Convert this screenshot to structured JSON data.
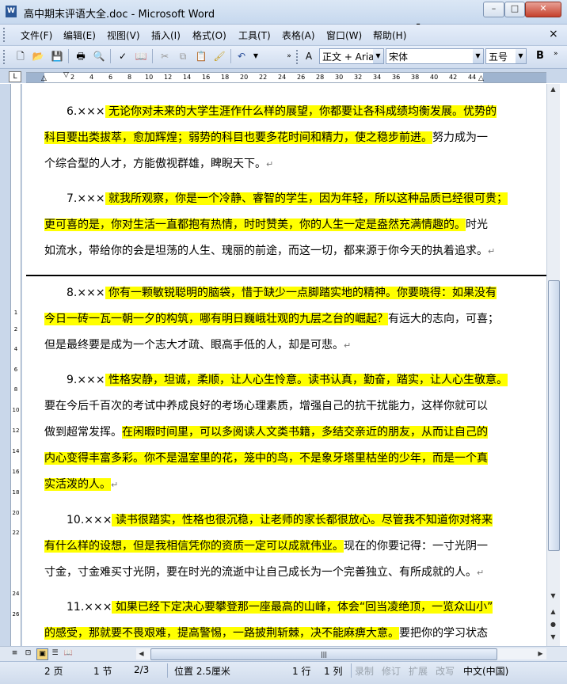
{
  "window": {
    "title": "高中期末评语大全.doc - Microsoft Word",
    "minimize": "–",
    "maximize": "□",
    "close": "✕"
  },
  "menu": [
    "文件(F)",
    "编辑(E)",
    "视图(V)",
    "插入(I)",
    "格式(O)",
    "工具(T)",
    "表格(A)",
    "窗口(W)",
    "帮助(H)"
  ],
  "menu_close": "×",
  "toolbar": {
    "style": "正文 + Aria",
    "font": "宋体",
    "size": "五号",
    "bold": "B"
  },
  "ruler": {
    "corner": "L",
    "numbers": [
      "2",
      "4",
      "6",
      "8",
      "10",
      "12",
      "14",
      "16",
      "18",
      "20",
      "22",
      "24",
      "26",
      "28",
      "30",
      "32",
      "34",
      "36",
      "38",
      "40",
      "42",
      "44"
    ],
    "vnumbers": [
      "1",
      "2",
      "4",
      "6",
      "8",
      "10",
      "12",
      "14",
      "16",
      "18",
      "20",
      "22",
      "24",
      "26"
    ]
  },
  "document": {
    "paragraphs": [
      {
        "id": "p6",
        "lines": [
          [
            {
              "t": "6.×××",
              "hl": false
            },
            {
              "t": " 无论你对未来的大学生涯作什么样的展望，你都要让各科成绩均衡发展。优势的",
              "hl": true
            }
          ],
          [
            {
              "t": "科目要出类拔萃，愈加辉煌；弱势的科目也要多花时间和精力，使之稳步前进。",
              "hl": true
            },
            {
              "t": "努力成为一",
              "hl": false
            }
          ],
          [
            {
              "t": "个综合型的人才，方能傲视群雄，睥睨天下。",
              "hl": false
            },
            {
              "t": "↵",
              "hl": false,
              "pm": true
            }
          ]
        ]
      },
      {
        "id": "p7",
        "lines": [
          [
            {
              "t": "7.×××",
              "hl": false
            },
            {
              "t": " 就我所观察，你是一个冷静、睿智的学生，因为年轻，所以这种品质已经很可贵；",
              "hl": true
            }
          ],
          [
            {
              "t": "更可喜的是，你对生活一直都抱有热情，时时赞美，你的人生一定是盎然充满情趣的。",
              "hl": true
            },
            {
              "t": "时光",
              "hl": false
            }
          ],
          [
            {
              "t": "如流水，带给你的会是坦荡的人生、瑰丽的前途，而这一切，都来源于你今天的执着追求。",
              "hl": false
            },
            {
              "t": "↵",
              "hl": false,
              "pm": true
            }
          ]
        ]
      },
      {
        "id": "p8",
        "lines": [
          [
            {
              "t": "8.×××",
              "hl": false
            },
            {
              "t": " 你有一颗敏锐聪明的脑袋，惜于缺少一点脚踏实地的精神。你要晓得：如果没有",
              "hl": true
            }
          ],
          [
            {
              "t": "今日一砖一瓦一朝一夕的构筑，哪有明日巍峨壮观的九层之台的崛起？",
              "hl": true
            },
            {
              "t": "有远大的志向，可喜；",
              "hl": false
            }
          ],
          [
            {
              "t": "但是最终要是成为一个志大才疏、眼高手低的人，却是可悲。",
              "hl": false
            },
            {
              "t": "↵",
              "hl": false,
              "pm": true
            }
          ]
        ]
      },
      {
        "id": "p9",
        "lines": [
          [
            {
              "t": "9.×××",
              "hl": false
            },
            {
              "t": " 性格安静，坦诚，柔顺，让人心生怜意。读书认真，勤奋，踏实，让人心生敬意。",
              "hl": true
            }
          ],
          [
            {
              "t": "要在今后千百次的考试中养成良好的考场心理素质，增强自己的抗干扰能力，这样你就可以",
              "hl": false
            }
          ],
          [
            {
              "t": "做到超常发挥。",
              "hl": false
            },
            {
              "t": "在闲暇时间里，可以多阅读人文类书籍，多结交亲近的朋友，从而让自己的",
              "hl": true
            }
          ],
          [
            {
              "t": "内心变得丰富多彩。你不是温室里的花，笼中的鸟，不是象牙塔里枯坐的少年，而是一个真",
              "hl": true
            }
          ],
          [
            {
              "t": "实活泼的人。",
              "hl": true
            },
            {
              "t": "↵",
              "hl": false,
              "pm": true
            }
          ]
        ]
      },
      {
        "id": "p10",
        "lines": [
          [
            {
              "t": "10.×××",
              "hl": false
            },
            {
              "t": " 读书很踏实，性格也很沉稳，让老师的家长都很放心。尽管我不知道你对将来",
              "hl": true
            }
          ],
          [
            {
              "t": "有什么样的设想，但是我相信凭你的资质一定可以成就伟业。",
              "hl": true
            },
            {
              "t": "现在的你要记得：一寸光阴一",
              "hl": false
            }
          ],
          [
            {
              "t": "寸金，寸金难买寸光阴，要在时光的流逝中让自己成长为一个完善独立、有所成就的人。",
              "hl": false
            },
            {
              "t": "↵",
              "hl": false,
              "pm": true
            }
          ]
        ]
      },
      {
        "id": "p11",
        "lines": [
          [
            {
              "t": "11.×××",
              "hl": false
            },
            {
              "t": " 如果已经下定决心要攀登那一座最高的山峰，体会“回当凌绝顶，一览众山小”",
              "hl": true
            }
          ],
          [
            {
              "t": "的感受，那就要不畏艰难，提高警惕，一路披荆斩棘，决不能麻痹大意。",
              "hl": true
            },
            {
              "t": "要把你的学习状态",
              "hl": false
            }
          ]
        ]
      }
    ]
  },
  "status": {
    "page": "2 页",
    "section": "1 节",
    "pages": "2/3",
    "position": "位置 2.5厘米",
    "line": "1 行",
    "column": "1 列",
    "rec": "录制",
    "trk": "修订",
    "ext": "扩展",
    "ovr": "改写",
    "lang": "中文(中国)"
  }
}
